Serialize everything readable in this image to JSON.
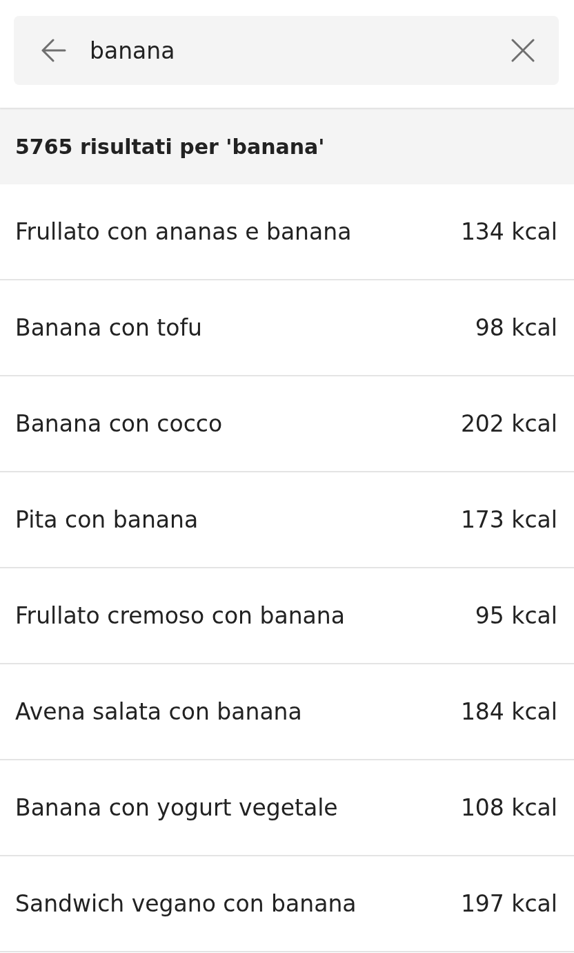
{
  "search": {
    "value": "banana"
  },
  "results_header": "5765 risultati per 'banana'",
  "results": [
    {
      "name": "Frullato con ananas e banana",
      "calories": "134 kcal"
    },
    {
      "name": "Banana con tofu",
      "calories": "98 kcal"
    },
    {
      "name": "Banana con cocco",
      "calories": "202 kcal"
    },
    {
      "name": "Pita con banana",
      "calories": "173 kcal"
    },
    {
      "name": "Frullato cremoso con banana",
      "calories": "95 kcal"
    },
    {
      "name": "Avena salata con banana",
      "calories": "184 kcal"
    },
    {
      "name": "Banana con yogurt vegetale",
      "calories": "108 kcal"
    },
    {
      "name": "Sandwich vegano con banana",
      "calories": "197 kcal"
    }
  ]
}
